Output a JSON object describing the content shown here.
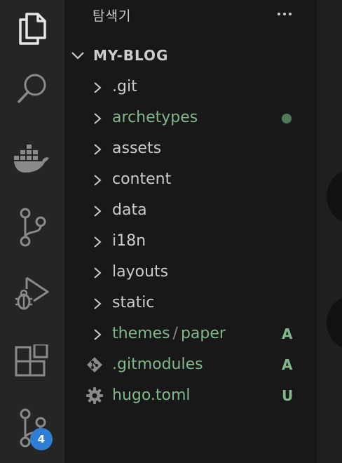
{
  "activity_bar": {
    "items": [
      {
        "icon": "files-icon"
      },
      {
        "icon": "search-icon"
      },
      {
        "icon": "docker-icon"
      },
      {
        "icon": "source-control-icon"
      },
      {
        "icon": "run-debug-icon"
      },
      {
        "icon": "extensions-icon"
      },
      {
        "icon": "source-control-badged-icon",
        "badge": "4"
      }
    ]
  },
  "sidebar": {
    "title": "탐색기",
    "section": {
      "title": "MY-BLOG",
      "items": [
        {
          "label": ".git",
          "type": "folder",
          "color": "#cccccc"
        },
        {
          "label": "archetypes",
          "type": "folder",
          "color": "#81b88b",
          "status": "modified-dot"
        },
        {
          "label": "assets",
          "type": "folder",
          "color": "#cccccc"
        },
        {
          "label": "content",
          "type": "folder",
          "color": "#cccccc"
        },
        {
          "label": "data",
          "type": "folder",
          "color": "#cccccc"
        },
        {
          "label": "i18n",
          "type": "folder",
          "color": "#cccccc"
        },
        {
          "label": "layouts",
          "type": "folder",
          "color": "#cccccc"
        },
        {
          "label": "static",
          "type": "folder",
          "color": "#cccccc"
        },
        {
          "label": "themes",
          "label_sub": "paper",
          "separator": "/",
          "type": "folder",
          "color": "#81b88b",
          "status": "A"
        },
        {
          "label": ".gitmodules",
          "type": "file",
          "icon": "git-file-icon",
          "color": "#81b88b",
          "status": "A"
        },
        {
          "label": "hugo.toml",
          "type": "file",
          "icon": "gear-icon",
          "color": "#81b88b",
          "status": "U"
        }
      ]
    }
  }
}
